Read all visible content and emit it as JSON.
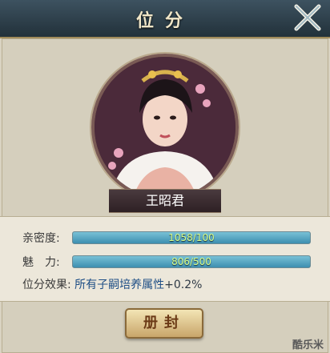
{
  "window": {
    "title": "位分"
  },
  "character": {
    "name": "王昭君"
  },
  "stats": {
    "intimacy": {
      "label": "亲密度:",
      "value_text": "1058/100",
      "progress": 1.0
    },
    "charm": {
      "label": "魅　力:",
      "value_text": "806/500",
      "progress": 1.0
    }
  },
  "effect": {
    "label": "位分效果:",
    "value": "所有子嗣培养属性",
    "bonus": "+0.2%"
  },
  "actions": {
    "confirm_label": "册封"
  },
  "watermark": "酷乐米",
  "colors": {
    "accent": "#c8a56a",
    "bar": "#3d8fb0",
    "bar_text": "#d8ff8a"
  }
}
